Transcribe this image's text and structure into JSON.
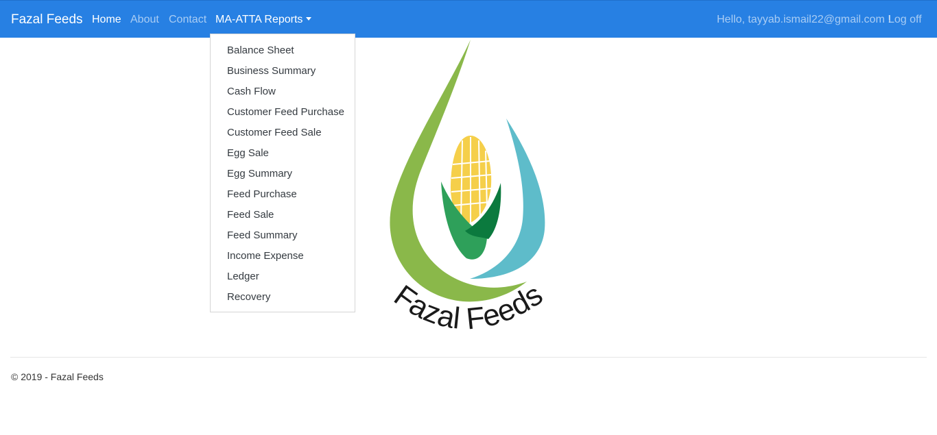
{
  "navbar": {
    "brand": "Fazal Feeds",
    "links": [
      {
        "label": "Home"
      },
      {
        "label": "About"
      },
      {
        "label": "Contact"
      }
    ],
    "reports_label": "MA-ATTA Reports",
    "greeting": "Hello, tayyab.ismail22@gmail.com !",
    "logoff_label": "Log off",
    "color": "#2780e3"
  },
  "reports_menu": {
    "items": [
      {
        "label": "Balance Sheet"
      },
      {
        "label": "Business Summary"
      },
      {
        "label": "Cash Flow"
      },
      {
        "label": "Customer Feed Purchase"
      },
      {
        "label": "Customer Feed Sale"
      },
      {
        "label": "Egg Sale"
      },
      {
        "label": "Egg Summary"
      },
      {
        "label": "Feed Purchase"
      },
      {
        "label": "Feed Sale"
      },
      {
        "label": "Feed Summary"
      },
      {
        "label": "Income Expense"
      },
      {
        "label": "Ledger"
      },
      {
        "label": "Recovery"
      }
    ]
  },
  "logo": {
    "text": "Fazal Feeds",
    "colors": {
      "green_drop": "#8ab84a",
      "blue_drop": "#5ebcca",
      "corn": "#f5cf4a",
      "leaf_light": "#2ea05a",
      "leaf_dark": "#0b7a3e",
      "text": "#1a1a1a"
    }
  },
  "footer": {
    "text": "© 2019 - Fazal Feeds"
  }
}
